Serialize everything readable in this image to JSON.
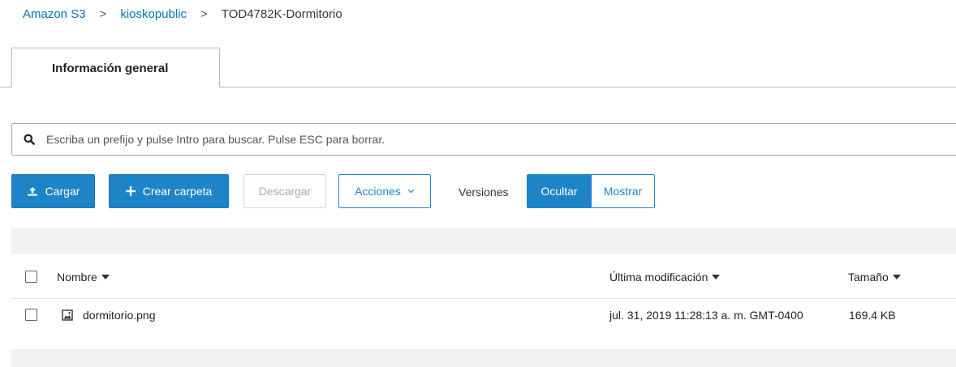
{
  "breadcrumb": {
    "root": "Amazon S3",
    "bucket": "kioskopublic",
    "folder": "TOD4782K-Dormitorio",
    "separator": ">"
  },
  "tabs": [
    {
      "label": "Información general",
      "active": true
    }
  ],
  "search": {
    "placeholder": "Escriba un prefijo y pulse Intro para buscar. Pulse ESC para borrar.",
    "value": "",
    "icon": "search-icon"
  },
  "toolbar": {
    "upload_label": "Cargar",
    "create_folder_label": "Crear carpeta",
    "download_label": "Descargar",
    "actions_label": "Acciones",
    "versions_label": "Versiones",
    "hide_label": "Ocultar",
    "show_label": "Mostrar",
    "versions_selected": "Ocultar"
  },
  "table": {
    "columns": {
      "name": "Nombre",
      "modified": "Última modificación",
      "size": "Tamaño"
    },
    "rows": [
      {
        "name": "dormitorio.png",
        "modified": "jul. 31, 2019 11:28:13 a. m. GMT-0400",
        "size": "169.4 KB",
        "icon": "image-file-icon"
      }
    ]
  },
  "colors": {
    "accent": "#1e84c8",
    "link": "#0073bb",
    "band": "#f2f2f2"
  }
}
